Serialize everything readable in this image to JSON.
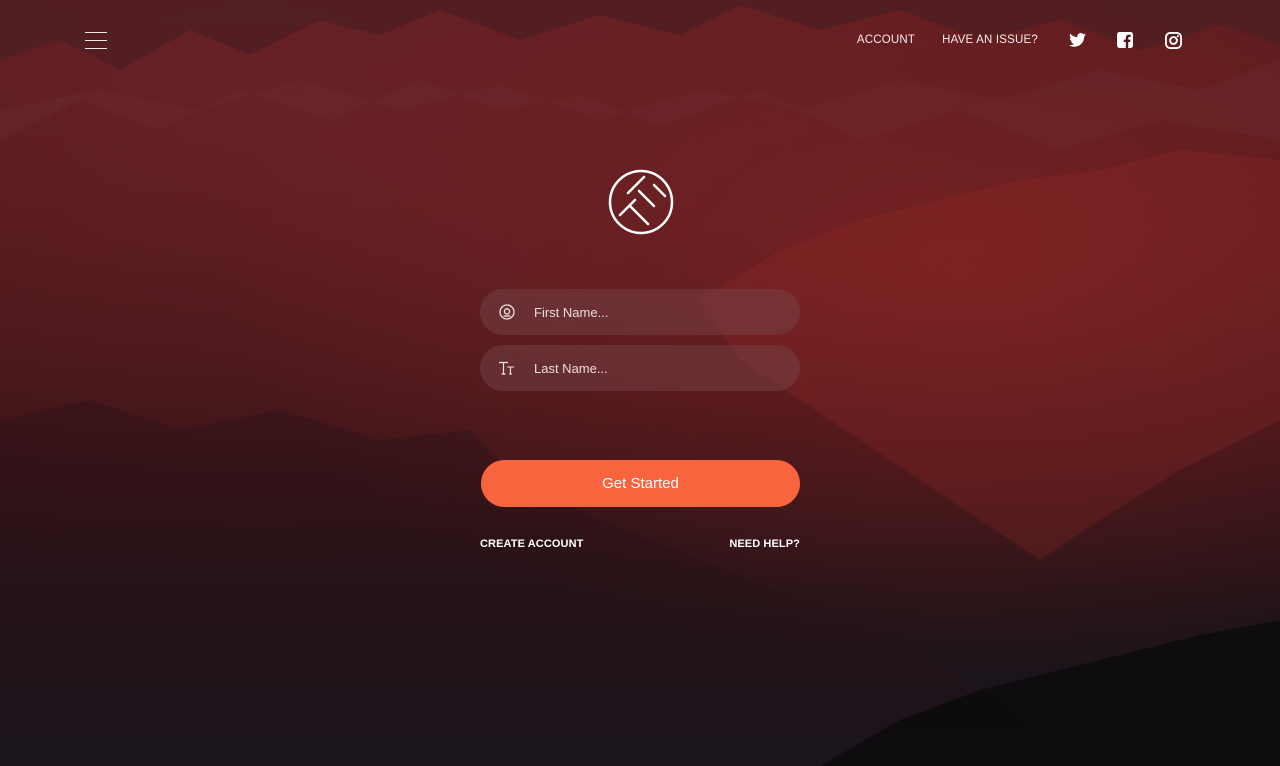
{
  "header": {
    "nav": {
      "account_label": "ACCOUNT",
      "issue_label": "HAVE AN ISSUE?"
    },
    "social": [
      "twitter-icon",
      "facebook-icon",
      "instagram-icon"
    ]
  },
  "form": {
    "first_name": {
      "value": "",
      "placeholder": "First Name...",
      "icon": "at-sign-icon"
    },
    "last_name": {
      "value": "",
      "placeholder": "Last Name...",
      "icon": "text-size-icon"
    },
    "submit_label": "Get Started"
  },
  "footer_links": {
    "create_account": "CREATE ACCOUNT",
    "need_help": "NEED HELP?"
  },
  "colors": {
    "accent": "#f7643d",
    "background_top": "#5a1c1f",
    "background_bottom": "#141620",
    "field_bg": "#6a3a3f"
  }
}
